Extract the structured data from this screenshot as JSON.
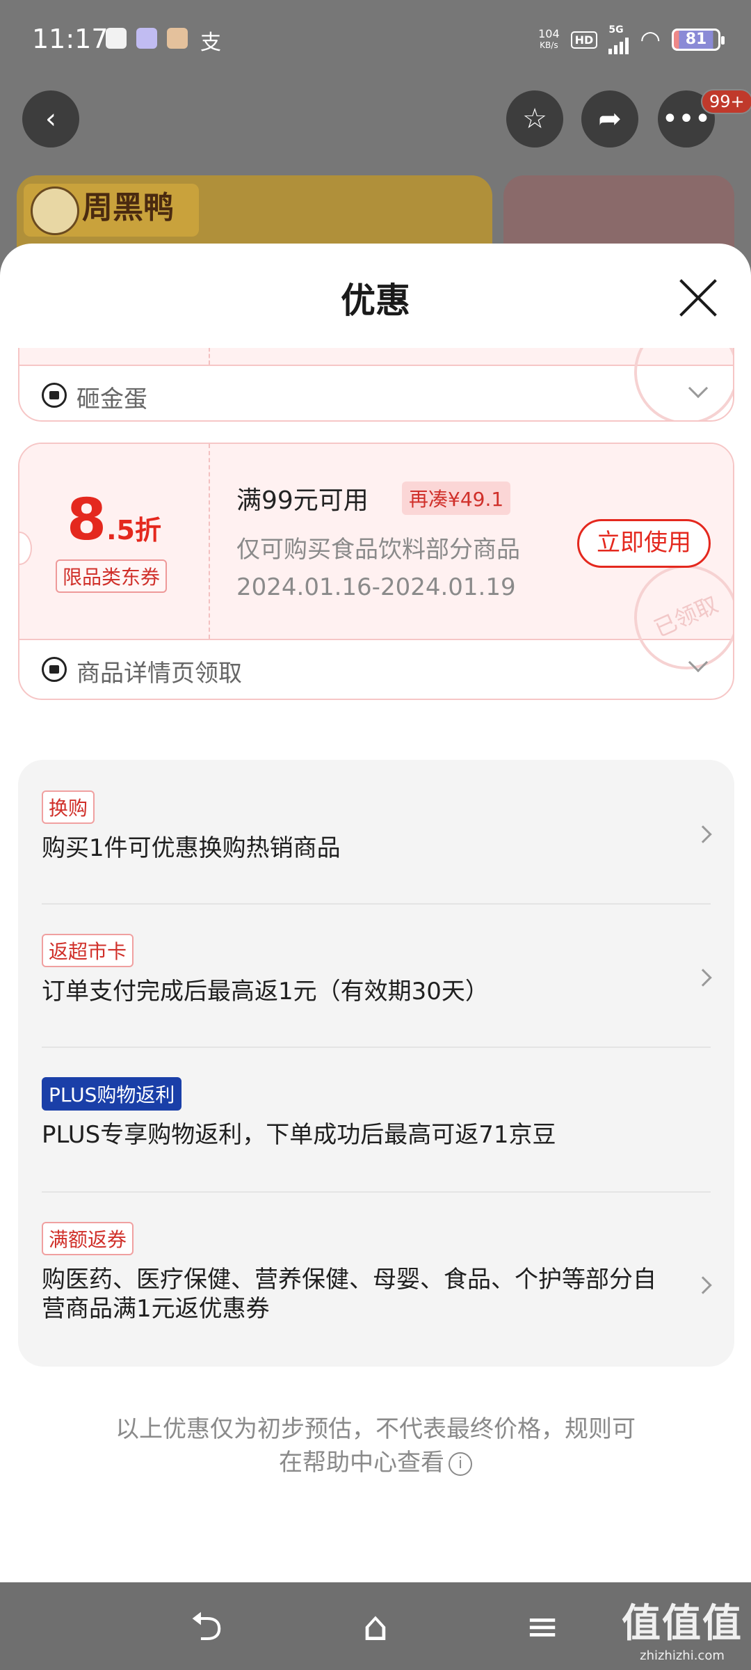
{
  "status_bar": {
    "time": "11:17",
    "net_speed": "104",
    "net_unit": "KB/s",
    "hd": "HD",
    "network": "5G",
    "battery": "81"
  },
  "header_badge": "99+",
  "brand_logo": "周黑鸭",
  "sheet": {
    "title": "优惠"
  },
  "coupons": [
    {
      "source": "砸金蛋"
    },
    {
      "discount_big": "8",
      "discount_small": ".5折",
      "limit_tag": "限品类东券",
      "title": "满99元可用",
      "extra_tag": "再凑¥49.1",
      "desc": "仅可购买食品饮料部分商品",
      "date_range": "2024.01.16-2024.01.19",
      "button": "立即使用",
      "stamp": "已领取",
      "source": "商品详情页领取"
    }
  ],
  "promos": [
    {
      "tag": "换购",
      "text": "购买1件可优惠换购热销商品"
    },
    {
      "tag": "返超市卡",
      "text": "订单支付完成后最高返1元（有效期30天）"
    },
    {
      "tag": "PLUS购物返利",
      "text": "PLUS专享购物返利，下单成功后最高可返71京豆"
    },
    {
      "tag": "满额返券",
      "text": "购医药、医疗保健、营养保健、母婴、食品、个护等部分自营商品满1元返优惠券"
    }
  ],
  "disclaimer": {
    "line1": "以上优惠仅为初步预估，不代表最终价格，规则可",
    "line2": "在帮助中心查看"
  },
  "watermark": {
    "big": "值值值",
    "small": "zhizhizhi.com"
  }
}
